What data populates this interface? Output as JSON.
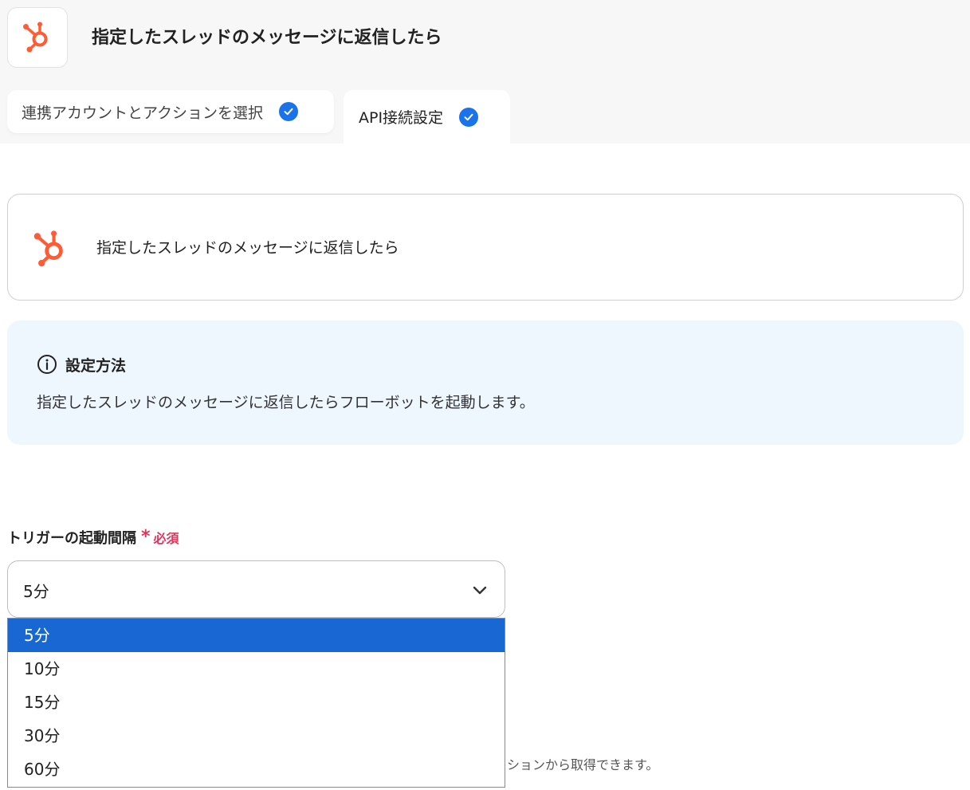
{
  "header": {
    "title": "指定したスレッドのメッセージに返信したら",
    "app_icon": "hubspot-logo-icon"
  },
  "tabs": [
    {
      "label": "連携アカウントとアクションを選択",
      "completed": true
    },
    {
      "label": "API接続設定",
      "completed": true
    }
  ],
  "action_card": {
    "title": "指定したスレッドのメッセージに返信したら"
  },
  "info": {
    "heading": "設定方法",
    "text": "指定したスレッドのメッセージに返信したらフローボットを起動します。"
  },
  "trigger_interval": {
    "label": "トリガーの起動間隔",
    "required_mark": "*",
    "required_text": "必須",
    "selected": "5分",
    "options": [
      "5分",
      "10分",
      "15分",
      "30分",
      "60分"
    ]
  },
  "partial_help_text": "ションから取得できます。",
  "colors": {
    "accent": "#1a73e8",
    "hubspot_orange": "#ff5c35",
    "required": "#e3345c",
    "option_highlight": "#1967d2",
    "info_bg": "#eef6fe"
  }
}
